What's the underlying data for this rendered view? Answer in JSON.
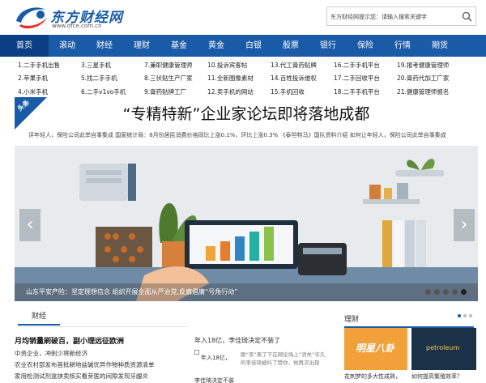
{
  "brand": {
    "name": "东方财经网",
    "url": "www.dfce.com.cn",
    "accent": "#1a5ba8"
  },
  "search": {
    "placeholder": "东方财经网提示您：请输入搜索关键字"
  },
  "nav": {
    "items": [
      "首页",
      "滚动",
      "财经",
      "理财",
      "基金",
      "黄金",
      "白银",
      "股票",
      "银行",
      "保险",
      "行情",
      "期货"
    ]
  },
  "links": {
    "rows": [
      [
        "1.二手手机出售",
        "3.三星手机",
        "7.兼职健康管理师",
        "10.投诉宾客帖",
        "13.代工膏药贴牌",
        "16.二手手机平台",
        "19.报考健康管理师"
      ],
      [
        "2.苹果手机",
        "5.找二手手机",
        "8.三伏贴生产厂家",
        "11.全新图像素材",
        "14.百姓投诉维权",
        "17.二手回收平台",
        "20.膏药代加工厂家"
      ],
      [
        "4.小米手机",
        "6.二手v1vo手机",
        "9.膏药贴牌工厂",
        "12.卖手机的网站",
        "15.手机回收",
        "18.二手手机平台",
        "21.健康管理师报名"
      ]
    ]
  },
  "headline": {
    "tag": "头条",
    "text": "“专精特新”企业家论坛即将落地成都"
  },
  "ticker": {
    "text": "评年轻人，保险公司此举自事集成    国家统计局：8月份居民消费价格同比上涨0.1%，环比上涨0.3%    《泰坦特马》国队资料介绍    如何让年轻人，保险公司此举自事集成"
  },
  "banner": {
    "caption": "山东平安产险：坚定理想信念 组织开展全面从严治党,反腐倡廉“号角行动”",
    "dot_count": 5,
    "active_dot": 4,
    "prev_arrow": "‹",
    "next_arrow": "›"
  },
  "finance": {
    "tab": "财经",
    "title": "月均销量刷破百，副小理远征欧洲",
    "items": [
      "中资企业，冲刺少将新经济",
      "农业农村部发布首批耕地盐碱优异作物种质资源清单",
      "家用检测试剂盒挟卖核实看芽医的间隙发现牙龈炎"
    ]
  },
  "middle": {
    "title": "年入18亿，李佳琦决定不装了",
    "img_label": "年入18亿，",
    "text": "眼“李”离了下在网论场上“消失”许久的李佳琦被抖了赞你，他再次出现",
    "bottom": "李佳琦决定不装"
  },
  "licai": {
    "tab": "理财",
    "page_count": 3,
    "active_page": 1,
    "thumb1_text": "明星八卦",
    "thumb2_text": "petroleum",
    "caption1": "花刺梦的多大性成熟，",
    "caption2": "如何提高繁殖效率？"
  }
}
